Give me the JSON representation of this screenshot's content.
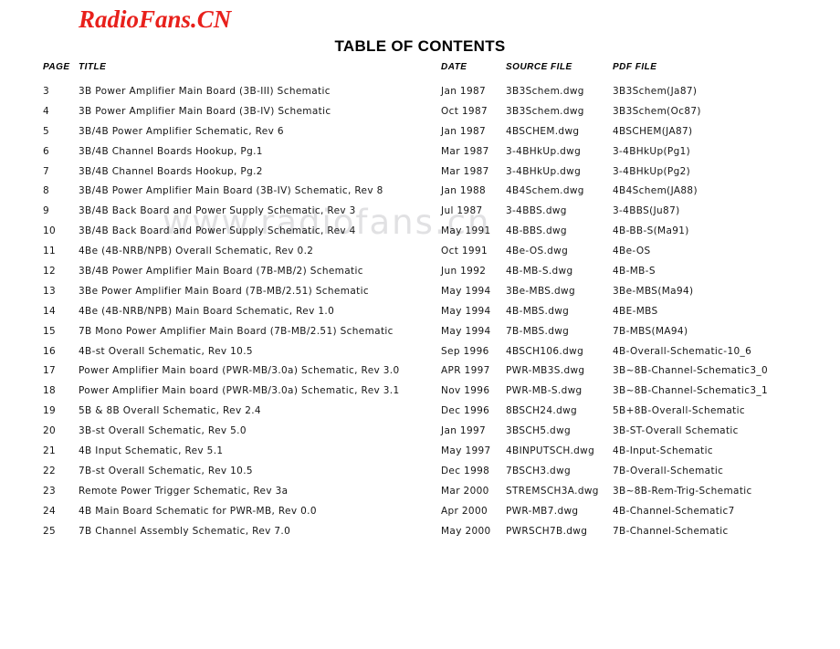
{
  "brand": {
    "text": "RadioFans.CN",
    "color": "#e8201b"
  },
  "document": {
    "title": "TABLE OF CONTENTS"
  },
  "watermark": {
    "text": "www.radiofans.cn"
  },
  "table": {
    "columns": [
      "PAGE",
      "TITLE",
      "DATE",
      "SOURCE FILE",
      "PDF FILE"
    ],
    "rows": [
      {
        "page": "3",
        "title": "3B Power Amplifier Main Board (3B-III) Schematic",
        "date": "Jan 1987",
        "source_file": "3B3Schem.dwg",
        "pdf_file": "3B3Schem(Ja87)"
      },
      {
        "page": "4",
        "title": "3B Power Amplifier Main Board (3B-IV) Schematic",
        "date": "Oct 1987",
        "source_file": "3B3Schem.dwg",
        "pdf_file": "3B3Schem(Oc87)"
      },
      {
        "page": "5",
        "title": "3B/4B Power Amplifier Schematic, Rev 6",
        "date": "Jan 1987",
        "source_file": "4BSCHEM.dwg",
        "pdf_file": "4BSCHEM(JA87)"
      },
      {
        "page": "6",
        "title": "3B/4B Channel Boards Hookup, Pg.1",
        "date": "Mar 1987",
        "source_file": "3-4BHkUp.dwg",
        "pdf_file": "3-4BHkUp(Pg1)"
      },
      {
        "page": "7",
        "title": "3B/4B Channel Boards Hookup, Pg.2",
        "date": "Mar 1987",
        "source_file": "3-4BHkUp.dwg",
        "pdf_file": "3-4BHkUp(Pg2)"
      },
      {
        "page": "8",
        "title": "3B/4B Power Amplifier Main Board (3B-IV) Schematic, Rev 8",
        "date": "Jan 1988",
        "source_file": "4B4Schem.dwg",
        "pdf_file": "4B4Schem(JA88)"
      },
      {
        "page": "9",
        "title": "3B/4B Back Board and Power Supply Schematic, Rev 3",
        "date": "Jul 1987",
        "source_file": "3-4BBS.dwg",
        "pdf_file": "3-4BBS(Ju87)"
      },
      {
        "page": "10",
        "title": "3B/4B Back Board and Power Supply Schematic, Rev 4",
        "date": "May 1991",
        "source_file": "4B-BBS.dwg",
        "pdf_file": "4B-BB-S(Ma91)"
      },
      {
        "page": "11",
        "title": "4Be (4B-NRB/NPB) Overall Schematic, Rev 0.2",
        "date": "Oct 1991",
        "source_file": "4Be-OS.dwg",
        "pdf_file": "4Be-OS"
      },
      {
        "page": "12",
        "title": "3B/4B Power Amplifier Main Board (7B-MB/2) Schematic",
        "date": "Jun 1992",
        "source_file": "4B-MB-S.dwg",
        "pdf_file": "4B-MB-S"
      },
      {
        "page": "13",
        "title": "3Be Power Amplifier Main Board (7B-MB/2.51) Schematic",
        "date": "May 1994",
        "source_file": "3Be-MBS.dwg",
        "pdf_file": "3Be-MBS(Ma94)"
      },
      {
        "page": "14",
        "title": "4Be (4B-NRB/NPB) Main Board  Schematic, Rev 1.0",
        "date": "May 1994",
        "source_file": "4B-MBS.dwg",
        "pdf_file": "4BE-MBS"
      },
      {
        "page": "15",
        "title": "7B Mono Power Amplifier Main Board (7B-MB/2.51) Schematic",
        "date": "May 1994",
        "source_file": "7B-MBS.dwg",
        "pdf_file": "7B-MBS(MA94)"
      },
      {
        "page": "16",
        "title": "4B-st Overall Schematic, Rev 10.5",
        "date": "Sep 1996",
        "source_file": "4BSCH106.dwg",
        "pdf_file": "4B-Overall-Schematic-10_6"
      },
      {
        "page": "17",
        "title": "Power Amplifier Main board (PWR-MB/3.0a) Schematic, Rev 3.0",
        "date": "APR 1997",
        "source_file": "PWR-MB3S.dwg",
        "pdf_file": "3B~8B-Channel-Schematic3_0"
      },
      {
        "page": "18",
        "title": "Power Amplifier Main board (PWR-MB/3.0a) Schematic, Rev 3.1",
        "date": "Nov 1996",
        "source_file": "PWR-MB-S.dwg",
        "pdf_file": "3B~8B-Channel-Schematic3_1"
      },
      {
        "page": "19",
        "title": "5B & 8B Overall Schematic, Rev 2.4",
        "date": "Dec 1996",
        "source_file": "8BSCH24.dwg",
        "pdf_file": "5B+8B-Overall-Schematic"
      },
      {
        "page": "20",
        "title": "3B-st Overall Schematic, Rev 5.0",
        "date": "Jan 1997",
        "source_file": "3BSCH5.dwg",
        "pdf_file": "3B-ST-Overall Schematic"
      },
      {
        "page": "21",
        "title": "4B Input Schematic, Rev 5.1",
        "date": "May 1997",
        "source_file": "4BINPUTSCH.dwg",
        "pdf_file": "4B-Input-Schematic"
      },
      {
        "page": "22",
        "title": "7B-st Overall Schematic, Rev 10.5",
        "date": "Dec 1998",
        "source_file": "7BSCH3.dwg",
        "pdf_file": "7B-Overall-Schematic"
      },
      {
        "page": "23",
        "title": "Remote Power Trigger Schematic, Rev 3a",
        "date": "Mar 2000",
        "source_file": "STREMSCH3A.dwg",
        "pdf_file": "3B~8B-Rem-Trig-Schematic"
      },
      {
        "page": "24",
        "title": "4B Main Board Schematic for PWR-MB, Rev 0.0",
        "date": "Apr 2000",
        "source_file": "PWR-MB7.dwg",
        "pdf_file": "4B-Channel-Schematic7"
      },
      {
        "page": "25",
        "title": "7B Channel Assembly Schematic, Rev 7.0",
        "date": "May 2000",
        "source_file": "PWRSCH7B.dwg",
        "pdf_file": "7B-Channel-Schematic"
      }
    ]
  }
}
